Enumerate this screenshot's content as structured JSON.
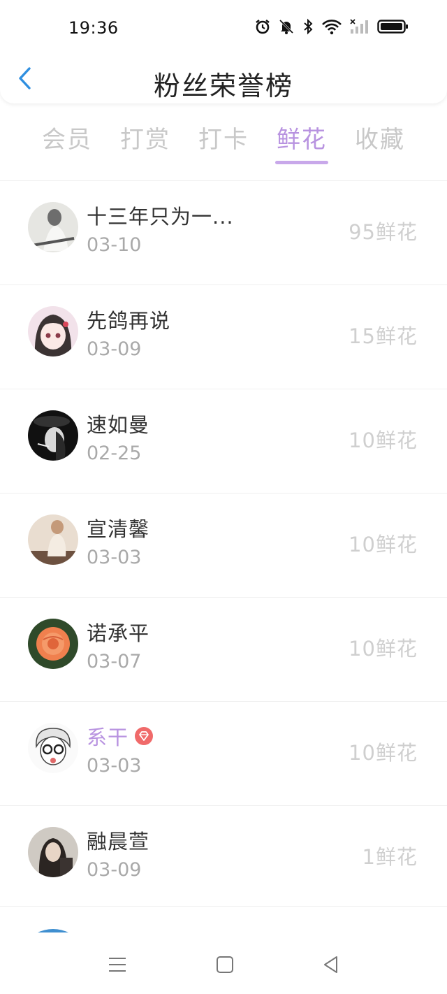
{
  "status_bar": {
    "time": "19:36"
  },
  "header": {
    "title": "粉丝荣誉榜"
  },
  "tabs": [
    {
      "label": "会员"
    },
    {
      "label": "打赏"
    },
    {
      "label": "打卡"
    },
    {
      "label": "鲜花",
      "active": true
    },
    {
      "label": "收藏"
    }
  ],
  "list": [
    {
      "name": "十三年只为一...",
      "date": "03-10",
      "amount": "95鲜花"
    },
    {
      "name": "先鸽再说",
      "date": "03-09",
      "amount": "15鲜花"
    },
    {
      "name": "速如曼",
      "date": "02-25",
      "amount": "10鲜花"
    },
    {
      "name": "宣清馨",
      "date": "03-03",
      "amount": "10鲜花"
    },
    {
      "name": "诺承平",
      "date": "03-07",
      "amount": "10鲜花"
    },
    {
      "name": "系干",
      "date": "03-03",
      "amount": "10鲜花",
      "vip_badge": "diamond-badge-icon"
    },
    {
      "name": "融晨萱",
      "date": "03-09",
      "amount": "1鲜花"
    }
  ],
  "colors": {
    "accent": "#b893e0",
    "back_arrow": "#2f8fe0",
    "amount_text": "#cfcfcf",
    "date_text": "#a9a9a9"
  }
}
